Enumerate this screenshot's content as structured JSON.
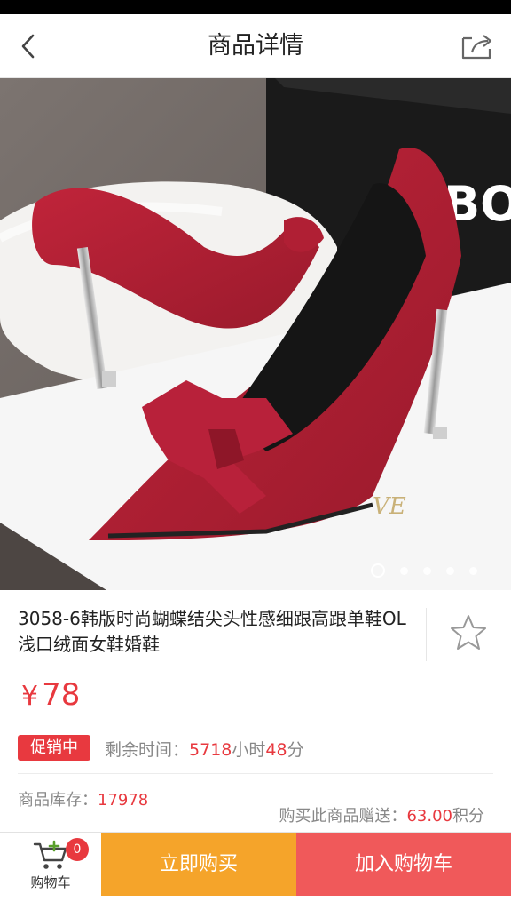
{
  "header": {
    "title": "商品详情"
  },
  "product": {
    "title": "3058-6韩版时尚蝴蝶结尖头性感细跟高跟单鞋OL浅口绒面女鞋婚鞋",
    "currency": "¥",
    "price": "78",
    "image_icon": "red-suede-bow-pump-photo",
    "carousel": {
      "count": 5,
      "active": 1
    }
  },
  "promotion": {
    "badge": "促销中",
    "remaining_label": "剩余时间：",
    "hours": "5718",
    "hours_unit": "小时",
    "minutes": "48",
    "minutes_unit": "分"
  },
  "stock": {
    "label": "商品库存：",
    "value": "17978"
  },
  "points": {
    "label": "购买此商品赠送：",
    "value": "63.00",
    "unit": "积分"
  },
  "bottom_bar": {
    "cart_label": "购物车",
    "cart_count": "0",
    "buy_now": "立即购买",
    "add_to_cart": "加入购物车"
  },
  "colors": {
    "accent_red": "#e8393f",
    "buy_orange": "#f5a42a",
    "cart_red": "#f0595a"
  }
}
